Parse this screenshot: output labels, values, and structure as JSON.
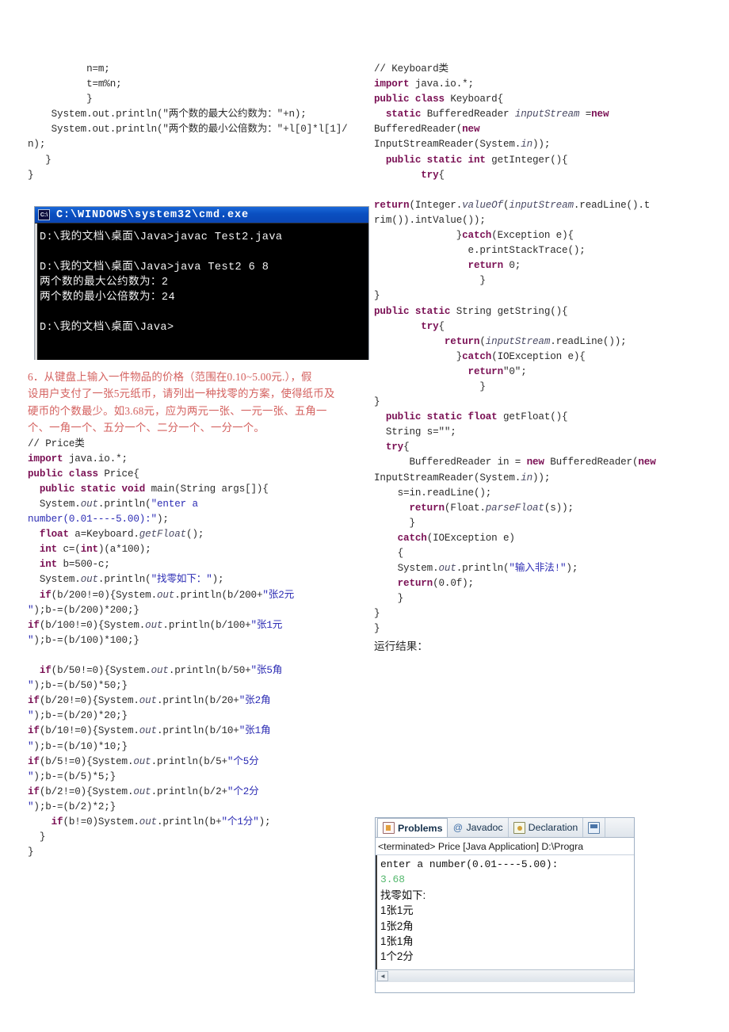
{
  "colors": {
    "keyword": "#7a1054",
    "string": "#2c2cb4",
    "field_italic": "#4a4a64",
    "red_text": "#d4615f",
    "cmd_title_bar": "#0a4fc0",
    "console_input_green": "#55b86e"
  },
  "left_column": {
    "code_top": [
      "          n=m;",
      "          t=m%n;",
      "          }",
      "    System.out.println(\"两个数的最大公约数为：\"+n);",
      "    System.out.println(\"两个数的最小公倍数为：\"+l[0]*l[1]/n);",
      "   }",
      "}"
    ],
    "problem": {
      "number": "6.",
      "lines": [
        "6．从键盘上输入一件物品的价格（范围在0.10~5.00元.），假",
        "设用户支付了一张5元纸币，请列出一种找零的方案，使得纸币及",
        "硬币的个数最少。如3.68元，应为两元一张、一元一张、五角一",
        "个、一角一个、五分一个、二分一个、一分一个。"
      ]
    },
    "comment_price": "// Price类",
    "price_code": [
      {
        "indent": 0,
        "parts": [
          {
            "t": "import ",
            "c": "kw"
          },
          {
            "t": "java.io.*;",
            "c": ""
          }
        ]
      },
      {
        "indent": 0,
        "parts": [
          {
            "t": "public class ",
            "c": "kw"
          },
          {
            "t": "Price{",
            "c": ""
          }
        ]
      },
      {
        "indent": 1,
        "parts": [
          {
            "t": "public static void ",
            "c": "kw"
          },
          {
            "t": "main(String args[]){",
            "c": ""
          }
        ]
      },
      {
        "indent": 1,
        "parts": [
          {
            "t": "System.",
            "c": ""
          },
          {
            "t": "out",
            "c": "fld"
          },
          {
            "t": ".println(",
            "c": ""
          },
          {
            "t": "\"enter a",
            "c": "str"
          }
        ]
      },
      {
        "indent": 0,
        "parts": [
          {
            "t": "number(0.01----5.00):\"",
            "c": "str"
          },
          {
            "t": ");",
            "c": ""
          }
        ]
      },
      {
        "indent": 1,
        "parts": [
          {
            "t": "float ",
            "c": "kw"
          },
          {
            "t": "a=Keyboard.",
            "c": ""
          },
          {
            "t": "getFloat",
            "c": "fld"
          },
          {
            "t": "();",
            "c": ""
          }
        ]
      },
      {
        "indent": 1,
        "parts": [
          {
            "t": "int ",
            "c": "kw"
          },
          {
            "t": "c=(",
            "c": ""
          },
          {
            "t": "int",
            "c": "kw"
          },
          {
            "t": ")(a*100);",
            "c": ""
          }
        ]
      },
      {
        "indent": 1,
        "parts": [
          {
            "t": "int ",
            "c": "kw"
          },
          {
            "t": "b=500-c;",
            "c": ""
          }
        ]
      },
      {
        "indent": 1,
        "parts": [
          {
            "t": "System.",
            "c": ""
          },
          {
            "t": "out",
            "c": "fld"
          },
          {
            "t": ".println(",
            "c": ""
          },
          {
            "t": "\"找零如下：\"",
            "c": "str"
          },
          {
            "t": ");",
            "c": ""
          }
        ]
      },
      {
        "indent": 1,
        "parts": [
          {
            "t": "if",
            "c": "kw"
          },
          {
            "t": "(b/200!=0){System.",
            "c": ""
          },
          {
            "t": "out",
            "c": "fld"
          },
          {
            "t": ".println(b/200+",
            "c": ""
          },
          {
            "t": "\"张2元",
            "c": "str"
          }
        ]
      },
      {
        "indent": 0,
        "parts": [
          {
            "t": "\"",
            "c": "str"
          },
          {
            "t": ");b-=(b/200)*200;}",
            "c": ""
          }
        ]
      },
      {
        "indent": 0,
        "parts": [
          {
            "t": "if",
            "c": "kw"
          },
          {
            "t": "(b/100!=0){System.",
            "c": ""
          },
          {
            "t": "out",
            "c": "fld"
          },
          {
            "t": ".println(b/100+",
            "c": ""
          },
          {
            "t": "\"张1元",
            "c": "str"
          }
        ]
      },
      {
        "indent": 0,
        "parts": [
          {
            "t": "\"",
            "c": "str"
          },
          {
            "t": ");b-=(b/100)*100;}",
            "c": ""
          }
        ]
      },
      {
        "indent": 0,
        "parts": []
      },
      {
        "indent": 1,
        "parts": [
          {
            "t": "if",
            "c": "kw"
          },
          {
            "t": "(b/50!=0){System.",
            "c": ""
          },
          {
            "t": "out",
            "c": "fld"
          },
          {
            "t": ".println(b/50+",
            "c": ""
          },
          {
            "t": "\"张5角",
            "c": "str"
          }
        ]
      },
      {
        "indent": 0,
        "parts": [
          {
            "t": "\"",
            "c": "str"
          },
          {
            "t": ");b-=(b/50)*50;}",
            "c": ""
          }
        ]
      },
      {
        "indent": 0,
        "parts": [
          {
            "t": "if",
            "c": "kw"
          },
          {
            "t": "(b/20!=0){System.",
            "c": ""
          },
          {
            "t": "out",
            "c": "fld"
          },
          {
            "t": ".println(b/20+",
            "c": ""
          },
          {
            "t": "\"张2角",
            "c": "str"
          }
        ]
      },
      {
        "indent": 0,
        "parts": [
          {
            "t": "\"",
            "c": "str"
          },
          {
            "t": ");b-=(b/20)*20;}",
            "c": ""
          }
        ]
      },
      {
        "indent": 0,
        "parts": [
          {
            "t": "if",
            "c": "kw"
          },
          {
            "t": "(b/10!=0){System.",
            "c": ""
          },
          {
            "t": "out",
            "c": "fld"
          },
          {
            "t": ".println(b/10+",
            "c": ""
          },
          {
            "t": "\"张1角",
            "c": "str"
          }
        ]
      },
      {
        "indent": 0,
        "parts": [
          {
            "t": "\"",
            "c": "str"
          },
          {
            "t": ");b-=(b/10)*10;}",
            "c": ""
          }
        ]
      },
      {
        "indent": 0,
        "parts": [
          {
            "t": "if",
            "c": "kw"
          },
          {
            "t": "(b/5!=0){System.",
            "c": ""
          },
          {
            "t": "out",
            "c": "fld"
          },
          {
            "t": ".println(b/5+",
            "c": ""
          },
          {
            "t": "\"个5分",
            "c": "str"
          }
        ]
      },
      {
        "indent": 0,
        "parts": [
          {
            "t": "\"",
            "c": "str"
          },
          {
            "t": ");b-=(b/5)*5;}",
            "c": ""
          }
        ]
      },
      {
        "indent": 0,
        "parts": [
          {
            "t": "if",
            "c": "kw"
          },
          {
            "t": "(b/2!=0){System.",
            "c": ""
          },
          {
            "t": "out",
            "c": "fld"
          },
          {
            "t": ".println(b/2+",
            "c": ""
          },
          {
            "t": "\"个2分",
            "c": "str"
          }
        ]
      },
      {
        "indent": 0,
        "parts": [
          {
            "t": "\"",
            "c": "str"
          },
          {
            "t": ");b-=(b/2)*2;}",
            "c": ""
          }
        ]
      },
      {
        "indent": 2,
        "parts": [
          {
            "t": "if",
            "c": "kw"
          },
          {
            "t": "(b!=0)System.",
            "c": ""
          },
          {
            "t": "out",
            "c": "fld"
          },
          {
            "t": ".println(b+",
            "c": ""
          },
          {
            "t": "\"个1分\"",
            "c": "str"
          },
          {
            "t": ");",
            "c": ""
          }
        ]
      },
      {
        "indent": 1,
        "parts": [
          {
            "t": "}",
            "c": ""
          }
        ]
      },
      {
        "indent": 0,
        "parts": [
          {
            "t": "}",
            "c": ""
          }
        ]
      }
    ]
  },
  "right_column": {
    "comment_keyboard": "// Keyboard类",
    "keyboard_code": [
      {
        "indent": 0,
        "parts": [
          {
            "t": "import ",
            "c": "kw"
          },
          {
            "t": "java.io.*;",
            "c": ""
          }
        ]
      },
      {
        "indent": 0,
        "parts": [
          {
            "t": "public class ",
            "c": "kw"
          },
          {
            "t": "Keyboard{",
            "c": ""
          }
        ]
      },
      {
        "indent": 1,
        "parts": [
          {
            "t": "static ",
            "c": "kw"
          },
          {
            "t": "BufferedReader ",
            "c": ""
          },
          {
            "t": "inputStream",
            "c": "fld"
          },
          {
            "t": " =",
            "c": ""
          },
          {
            "t": "new",
            "c": "kw"
          }
        ]
      },
      {
        "indent": 0,
        "parts": [
          {
            "t": "BufferedReader(",
            "c": ""
          },
          {
            "t": "new",
            "c": "kw"
          }
        ]
      },
      {
        "indent": 0,
        "parts": [
          {
            "t": "InputStreamReader(System.",
            "c": ""
          },
          {
            "t": "in",
            "c": "fld"
          },
          {
            "t": "));",
            "c": ""
          }
        ]
      },
      {
        "indent": 1,
        "parts": [
          {
            "t": "public static int ",
            "c": "kw"
          },
          {
            "t": "getInteger(){",
            "c": ""
          }
        ]
      },
      {
        "indent": 4,
        "parts": [
          {
            "t": "try",
            "c": "kw"
          },
          {
            "t": "{",
            "c": ""
          }
        ]
      },
      {
        "indent": 0,
        "parts": []
      },
      {
        "indent": 0,
        "parts": [
          {
            "t": "return",
            "c": "kw"
          },
          {
            "t": "(Integer.",
            "c": ""
          },
          {
            "t": "valueOf",
            "c": "fld"
          },
          {
            "t": "(",
            "c": ""
          },
          {
            "t": "inputStream",
            "c": "fld"
          },
          {
            "t": ".readLine().t",
            "c": ""
          }
        ]
      },
      {
        "indent": 0,
        "parts": [
          {
            "t": "rim()).intValue());",
            "c": ""
          }
        ]
      },
      {
        "indent": 7,
        "parts": [
          {
            "t": "}",
            "c": ""
          },
          {
            "t": "catch",
            "c": "kw"
          },
          {
            "t": "(Exception e){",
            "c": ""
          }
        ]
      },
      {
        "indent": 8,
        "parts": [
          {
            "t": "e.printStackTrace();",
            "c": ""
          }
        ]
      },
      {
        "indent": 8,
        "parts": [
          {
            "t": "return ",
            "c": "kw"
          },
          {
            "t": "0;",
            "c": ""
          }
        ]
      },
      {
        "indent": 9,
        "parts": [
          {
            "t": "}",
            "c": ""
          }
        ]
      },
      {
        "indent": 0,
        "parts": [
          {
            "t": "}",
            "c": ""
          }
        ]
      },
      {
        "indent": 0,
        "parts": [
          {
            "t": "public static ",
            "c": "kw"
          },
          {
            "t": "String getString(){",
            "c": ""
          }
        ]
      },
      {
        "indent": 4,
        "parts": [
          {
            "t": "try",
            "c": "kw"
          },
          {
            "t": "{",
            "c": ""
          }
        ]
      },
      {
        "indent": 6,
        "parts": [
          {
            "t": "return",
            "c": "kw"
          },
          {
            "t": "(",
            "c": ""
          },
          {
            "t": "inputStream",
            "c": "fld"
          },
          {
            "t": ".readLine());",
            "c": ""
          }
        ]
      },
      {
        "indent": 7,
        "parts": [
          {
            "t": "}",
            "c": ""
          },
          {
            "t": "catch",
            "c": "kw"
          },
          {
            "t": "(IOException e){",
            "c": ""
          }
        ]
      },
      {
        "indent": 8,
        "parts": [
          {
            "t": "return",
            "c": "kw"
          },
          {
            "t": "\"0\";",
            "c": ""
          }
        ]
      },
      {
        "indent": 9,
        "parts": [
          {
            "t": "}",
            "c": ""
          }
        ]
      },
      {
        "indent": 0,
        "parts": [
          {
            "t": "}",
            "c": ""
          }
        ]
      },
      {
        "indent": 1,
        "parts": [
          {
            "t": "public static float ",
            "c": "kw"
          },
          {
            "t": "getFloat(){",
            "c": ""
          }
        ]
      },
      {
        "indent": 1,
        "parts": [
          {
            "t": "String s=\"\";",
            "c": ""
          }
        ]
      },
      {
        "indent": 1,
        "parts": [
          {
            "t": "try",
            "c": "kw"
          },
          {
            "t": "{",
            "c": ""
          }
        ]
      },
      {
        "indent": 3,
        "parts": [
          {
            "t": "BufferedReader in = ",
            "c": ""
          },
          {
            "t": "new ",
            "c": "kw"
          },
          {
            "t": "BufferedReader(",
            "c": ""
          },
          {
            "t": "new",
            "c": "kw"
          }
        ]
      },
      {
        "indent": 0,
        "parts": [
          {
            "t": "InputStreamReader(System.",
            "c": ""
          },
          {
            "t": "in",
            "c": "fld"
          },
          {
            "t": "));",
            "c": ""
          }
        ]
      },
      {
        "indent": 2,
        "parts": [
          {
            "t": "s=in.readLine();",
            "c": ""
          }
        ]
      },
      {
        "indent": 3,
        "parts": [
          {
            "t": "return",
            "c": "kw"
          },
          {
            "t": "(Float.",
            "c": ""
          },
          {
            "t": "parseFloat",
            "c": "fld"
          },
          {
            "t": "(s));",
            "c": ""
          }
        ]
      },
      {
        "indent": 3,
        "parts": [
          {
            "t": "}",
            "c": ""
          }
        ]
      },
      {
        "indent": 2,
        "parts": [
          {
            "t": "catch",
            "c": "kw"
          },
          {
            "t": "(IOException e)",
            "c": ""
          }
        ]
      },
      {
        "indent": 2,
        "parts": [
          {
            "t": "{",
            "c": ""
          }
        ]
      },
      {
        "indent": 2,
        "parts": [
          {
            "t": "System.",
            "c": ""
          },
          {
            "t": "out",
            "c": "fld"
          },
          {
            "t": ".println(",
            "c": ""
          },
          {
            "t": "\"输入非法!\"",
            "c": "str"
          },
          {
            "t": ");",
            "c": ""
          }
        ]
      },
      {
        "indent": 2,
        "parts": [
          {
            "t": "return",
            "c": "kw"
          },
          {
            "t": "(0.0f);",
            "c": ""
          }
        ]
      },
      {
        "indent": 2,
        "parts": [
          {
            "t": "}",
            "c": ""
          }
        ]
      },
      {
        "indent": 0,
        "parts": [
          {
            "t": "}",
            "c": ""
          }
        ]
      },
      {
        "indent": 0,
        "parts": [
          {
            "t": "}",
            "c": ""
          }
        ]
      }
    ],
    "result_label": "运行结果："
  },
  "cmd_window": {
    "icon_label": "C:\\",
    "title": "C:\\WINDOWS\\system32\\cmd.exe",
    "lines": [
      "D:\\我的文档\\桌面\\Java>javac Test2.java",
      "",
      "D:\\我的文档\\桌面\\Java>java Test2 6 8",
      "两个数的最大公约数为：2",
      "两个数的最小公倍数为：24",
      "",
      "D:\\我的文档\\桌面\\Java>"
    ]
  },
  "eclipse_console": {
    "tabs": [
      {
        "label": "Problems",
        "icon": "problems-icon",
        "active": true
      },
      {
        "label": "Javadoc",
        "icon": "at-icon",
        "active": false
      },
      {
        "label": "Declaration",
        "icon": "declaration-icon",
        "active": false
      },
      {
        "label": "",
        "icon": "console-icon",
        "active": false
      }
    ],
    "status_line": "<terminated> Price [Java Application] D:\\Progra",
    "output": [
      {
        "text": "enter a number(0.01----5.00):",
        "style": "mono"
      },
      {
        "text": "3.68",
        "style": "input"
      },
      {
        "text": "找零如下:",
        "style": "cn"
      },
      {
        "text": "1张1元",
        "style": "cn"
      },
      {
        "text": "1张2角",
        "style": "cn"
      },
      {
        "text": "1张1角",
        "style": "cn"
      },
      {
        "text": "1个2分",
        "style": "cn"
      }
    ],
    "scroll_arrow": "◄"
  }
}
